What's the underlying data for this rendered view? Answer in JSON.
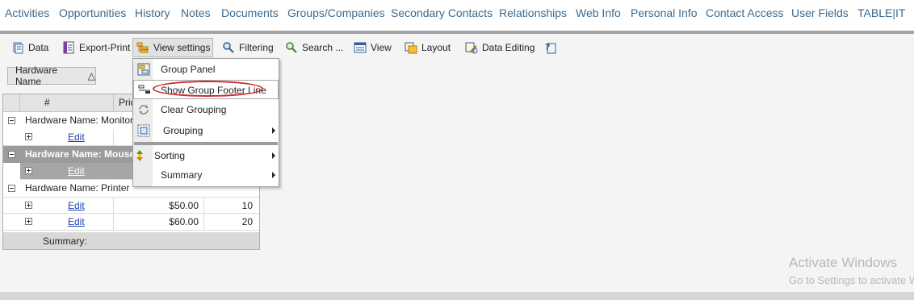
{
  "nav": {
    "items": [
      "Activities",
      "Opportunities",
      "History",
      "Notes",
      "Documents",
      "Groups/Companies",
      "Secondary Contacts",
      "Relationships",
      "Web Info",
      "Personal Info",
      "Contact Access",
      "User Fields",
      "TABLE|IT"
    ]
  },
  "toolbar": {
    "data_label": "Data",
    "export_label": "Export-Print",
    "view_settings_label": "View settings",
    "filtering_label": "Filtering",
    "search_label": "Search ...",
    "view_label": "View",
    "layout_label": "Layout",
    "data_editing_label": "Data Editing"
  },
  "group_panel": {
    "chip_label": "Hardware Name",
    "sort_glyph": "△"
  },
  "grid": {
    "columns": [
      "#",
      "Pric"
    ],
    "groups": [
      {
        "label": "Hardware Name: Monitor",
        "rows": [
          {
            "action": "Edit",
            "price": "",
            "qty": ""
          }
        ]
      },
      {
        "label": "Hardware Name: Mouse",
        "rows": [
          {
            "action": "Edit",
            "price": "",
            "qty": ""
          }
        ]
      },
      {
        "label": "Hardware Name: Printer",
        "rows": [
          {
            "action": "Edit",
            "price": "$50.00",
            "qty": "10"
          },
          {
            "action": "Edit",
            "price": "$60.00",
            "qty": "20"
          }
        ]
      }
    ],
    "summary_label": "Summary:"
  },
  "menu": {
    "group_panel": "Group Panel",
    "show_group_footer": "Show Group Footer Line",
    "clear_grouping": "Clear Grouping",
    "grouping": "Grouping",
    "sorting": "Sorting",
    "summary": "Summary"
  },
  "watermark": {
    "line1": "Activate Windows",
    "line2": "Go to Settings to activate Windows."
  },
  "colors": {
    "nav_link": "#3b6a8f",
    "highlight_oval": "#cc2b2b",
    "selected_group": "#9b9b9b"
  }
}
